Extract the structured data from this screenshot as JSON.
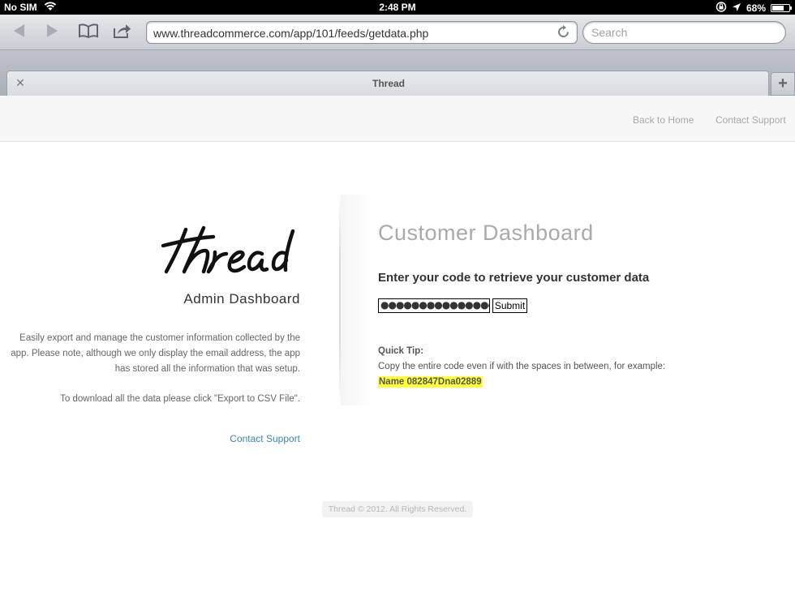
{
  "status_bar": {
    "carrier": "No SIM",
    "time": "2:48 PM",
    "battery": "68%",
    "battery_level": 0.68
  },
  "toolbar": {
    "url": "www.threadcommerce.com/app/101/feeds/getdata.php",
    "search_placeholder": "Search",
    "icons": [
      "back-arrow-icon",
      "forward-arrow-icon",
      "bookmarks-icon",
      "share-icon",
      "reload-icon"
    ]
  },
  "tabs": {
    "active_title": "Thread"
  },
  "header": {
    "nav": [
      "Back to Home",
      "Contact Support"
    ]
  },
  "left": {
    "logo": "thread",
    "title": "Admin Dashboard",
    "description": "Easily export and manage the customer information collected by the app. Please note, although we only display the email address, the app has stored all the information that was setup.",
    "download_note": "To download all the data please click \"Export to CSV File\".",
    "support_link": "Contact Support"
  },
  "right": {
    "title": "Customer Dashboard",
    "prompt": "Enter your code to retrieve your customer data",
    "code_value": "●●●●●●●●●●●●●●●●●●●",
    "submit_label": "Submit",
    "tip_heading": "Quick Tip:",
    "tip_text": "Copy the entire code even if with the spaces in between, for example:",
    "tip_example": "Name 082847Dna02889",
    "highlight_color": "#ffff3a"
  },
  "footer": {
    "text": "Thread © 2012. All Rights Reserved."
  }
}
